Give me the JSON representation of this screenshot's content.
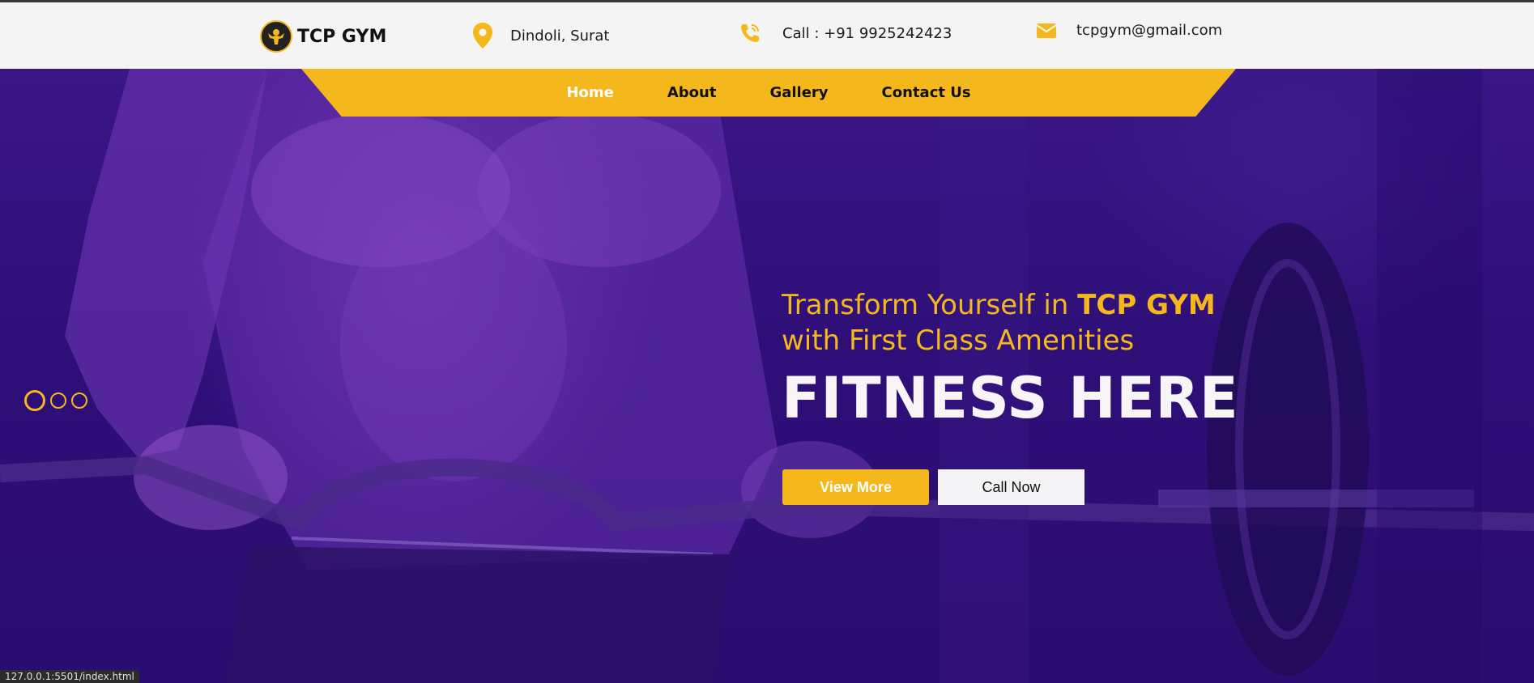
{
  "brand": {
    "name": "TCP GYM",
    "logo_icon": "bodybuilder-logo-icon"
  },
  "contact": {
    "location": "Dindoli, Surat",
    "phone": "Call : +91 9925242423",
    "email": "tcpgym@gmail.com",
    "accent": "#f5b81c"
  },
  "nav": {
    "items": [
      {
        "label": "Home",
        "active": true
      },
      {
        "label": "About"
      },
      {
        "label": "Gallery"
      },
      {
        "label": "Contact Us"
      }
    ]
  },
  "hero": {
    "line1_prefix": "Transform Yourself in ",
    "line1_bold": "TCP GYM",
    "line2": "with First Class Amenities",
    "headline": "FITNESS HERE",
    "primary_button": "View More",
    "secondary_button": "Call Now",
    "slider": {
      "count": 3,
      "active_index": 0
    }
  },
  "status_bar": {
    "url": "127.0.0.1:5501/index.html"
  },
  "colors": {
    "accent": "#f5b81c",
    "hero_overlay": "#2e0f78",
    "topbar": "#f4f4f4"
  }
}
